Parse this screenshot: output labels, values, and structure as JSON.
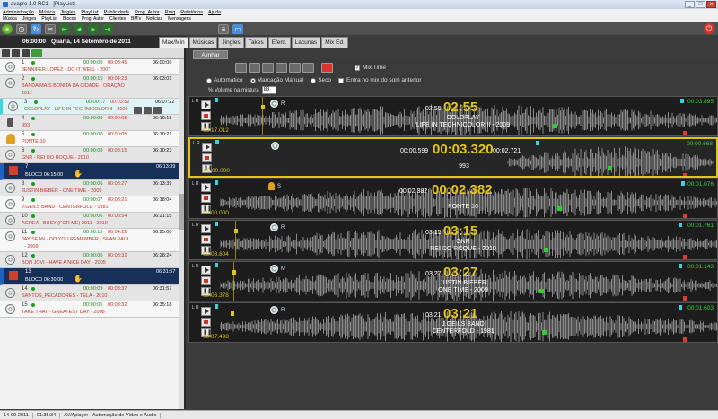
{
  "window": {
    "title": "avapro 1.0 RC1 - [PlayList]",
    "min": "_",
    "max": "□",
    "close": "x"
  },
  "menu": [
    "Administração",
    "Música",
    "Jingles",
    "PlayList",
    "Publicidade",
    "Prog. Autor",
    "Rmq",
    "Relatórios",
    "Ajuda"
  ],
  "submenu": [
    "Música",
    "Jingles",
    "PlayList",
    "Blocos",
    "Prog. Autor",
    "Clientes",
    "BM's",
    "Notícias",
    "Mensagens"
  ],
  "header": {
    "time": "06:00:00",
    "date": "Quarta, 14 Setembro de 2011"
  },
  "tabs": [
    "Max/Min",
    "Músicas",
    "Jingles",
    "Takes",
    "Efem.",
    "Lacunas",
    "Mix Ed."
  ],
  "alinhar": "Alinhar",
  "mix": {
    "mix_time_label": "Mix Time",
    "mix_time_checked": true,
    "radio_auto": "Automático",
    "radio_manual": "Marcação Manual",
    "radio_seco": "Seco",
    "entra_label": "Entra no mix do som anterior",
    "volume_label": "% Volume na mistura",
    "volume_value": "83"
  },
  "playlist": [
    {
      "num": "1",
      "t1": "00:00:00",
      "t2": "00:03:45",
      "t3": "06:00:00",
      "title": "JENNIFER LOPEZ - DO IT WELL - 2007",
      "kind": "cd"
    },
    {
      "num": "2",
      "t1": "00:00:15",
      "t2": "00:04:23",
      "t3": "06:03:01",
      "title": "BANDA MAIS BONITA DA CIDADE - ORAÇÃO",
      "title2": "2011",
      "kind": "cd"
    },
    {
      "num": "3",
      "t1": "00:00:17",
      "t2": "00:03:52",
      "t3": "06:07:22",
      "title": "COLDPLAY - LIFE IN TECHNICOLOR II - 2009",
      "kind": "cd",
      "selected": true
    },
    {
      "num": "4",
      "t1": "00:00:00",
      "t2": "00:00:05",
      "t3": "06:10:18",
      "title": "993",
      "kind": "mic"
    },
    {
      "num": "5",
      "t1": "00:00:00",
      "t2": "00:00:05",
      "t3": "06:10:21",
      "title": "PONTE 10",
      "kind": "bell"
    },
    {
      "num": "6",
      "t1": "00:00:08",
      "t2": "00:03:15",
      "t3": "06:10:23",
      "title": "GNR - REI DO ROQUE - 2010",
      "kind": "cd"
    },
    {
      "num": "7",
      "t3": "06:13:39",
      "title": "BLOCO 06:15:00",
      "kind": "bloco"
    },
    {
      "num": "8",
      "t1": "00:00:06",
      "t2": "00:03:27",
      "t3": "06:13:39",
      "title": "JUSTIN BIEBER - ONE TIME - 2009",
      "kind": "cd"
    },
    {
      "num": "9",
      "t1": "00:00:07",
      "t2": "00:03:21",
      "t3": "06:18:04",
      "title": "J.GEILS BAND - CENTERFOLD - 1981",
      "kind": "cd"
    },
    {
      "num": "10",
      "t1": "00:00:06",
      "t2": "00:03:54",
      "t3": "06:21:15",
      "title": "AGREA - BUSY (FOR ME) 2011 - 2010",
      "kind": "cd"
    },
    {
      "num": "11",
      "t1": "00:00:15",
      "t2": "00:04:22",
      "t3": "06:25:00",
      "title": "JAY SEAN - DO YOU REMEMBER | SEAN PAUL",
      "title2": "| - 2009",
      "kind": "cd"
    },
    {
      "num": "12",
      "t1": "00:00:06",
      "t2": "00:03:32",
      "t3": "06:28:24",
      "title": "BON JOVI - HAVE A NICE DAY - 2005",
      "kind": "cd"
    },
    {
      "num": "13",
      "t3": "06:31:57",
      "title": "BLOCO 06:30:00",
      "kind": "bloco"
    },
    {
      "num": "14",
      "t1": "00:00:09",
      "t2": "00:03:37",
      "t3": "06:31:57",
      "title": "SANTOS_PECADORES - TELA - 2010",
      "kind": "cd"
    },
    {
      "num": "15",
      "t1": "00:00:05",
      "t2": "00:03:32",
      "t3": "06:35:18",
      "title": "TAKE THAT - GREATEST DAY - 2008",
      "kind": "cd"
    }
  ],
  "decks": [
    {
      "badge": "R",
      "time_left": "00:17.012",
      "time_right": "00:03.895",
      "cd_left": "02:55",
      "cd_big": "02:55",
      "cd_right": "",
      "artist": "COLDPLAY",
      "song": "LIFE IN TECHNICOLOR II - 2009"
    },
    {
      "badge": "",
      "time_left": "00:00.000",
      "time_right": "00:00.668",
      "cd_left": "00:00.599",
      "cd_big": "00:03.320",
      "cd_right": "00:02.721",
      "artist": "",
      "song": "993"
    },
    {
      "badge": "S",
      "time_left": "00:00.000",
      "time_right": "00:01.076",
      "cd_left": "00:02.382",
      "cd_big": "00:02.382",
      "cd_right": "",
      "artist": "",
      "song": "PONTE 10"
    },
    {
      "badge": "R",
      "time_left": "00:08.804",
      "time_right": "00:01.761",
      "cd_left": "03:15",
      "cd_big": "03:15",
      "cd_right": "",
      "artist": "GNR",
      "song": "REI DO ROQUE - 2010"
    },
    {
      "badge": "M",
      "time_left": "00:06.378",
      "time_right": "00:01.143",
      "cd_left": "03:27",
      "cd_big": "03:27",
      "cd_right": "",
      "artist": "JUSTIN BIEBER",
      "song": "ONE TIME - 2009"
    },
    {
      "badge": "R",
      "time_left": "00:07.498",
      "time_right": "00:01.603",
      "cd_left": "03:21",
      "cd_big": "03:21",
      "cd_right": "",
      "artist": "J.GEILS BAND",
      "song": "CENTERFOLD - 1981"
    }
  ],
  "statusbar": {
    "date": "14-09-2011",
    "time": "01:35:34",
    "app": "AV/Aplayer - Automação de Vídeo e Áudio"
  }
}
